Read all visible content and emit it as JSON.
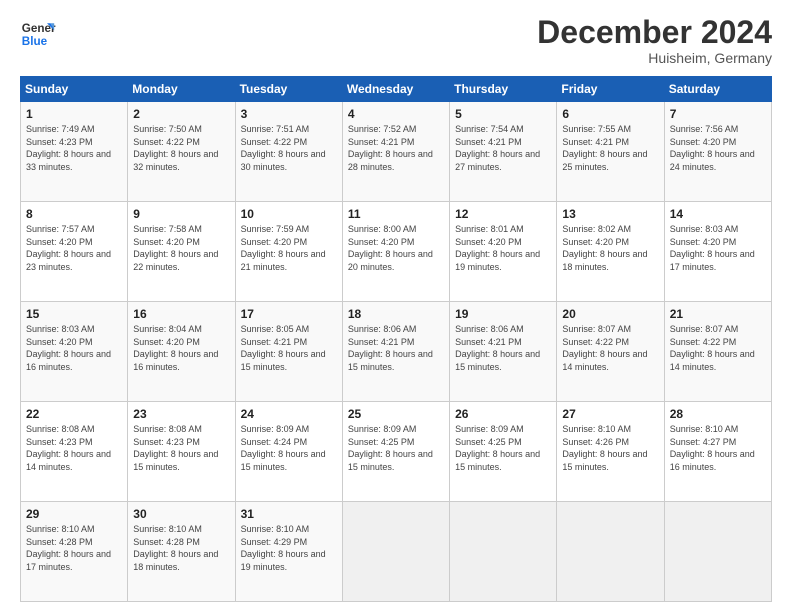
{
  "header": {
    "logo_line1": "General",
    "logo_line2": "Blue",
    "month_title": "December 2024",
    "location": "Huisheim, Germany"
  },
  "days_of_week": [
    "Sunday",
    "Monday",
    "Tuesday",
    "Wednesday",
    "Thursday",
    "Friday",
    "Saturday"
  ],
  "weeks": [
    [
      {
        "day": "1",
        "sunrise": "Sunrise: 7:49 AM",
        "sunset": "Sunset: 4:23 PM",
        "daylight": "Daylight: 8 hours and 33 minutes."
      },
      {
        "day": "2",
        "sunrise": "Sunrise: 7:50 AM",
        "sunset": "Sunset: 4:22 PM",
        "daylight": "Daylight: 8 hours and 32 minutes."
      },
      {
        "day": "3",
        "sunrise": "Sunrise: 7:51 AM",
        "sunset": "Sunset: 4:22 PM",
        "daylight": "Daylight: 8 hours and 30 minutes."
      },
      {
        "day": "4",
        "sunrise": "Sunrise: 7:52 AM",
        "sunset": "Sunset: 4:21 PM",
        "daylight": "Daylight: 8 hours and 28 minutes."
      },
      {
        "day": "5",
        "sunrise": "Sunrise: 7:54 AM",
        "sunset": "Sunset: 4:21 PM",
        "daylight": "Daylight: 8 hours and 27 minutes."
      },
      {
        "day": "6",
        "sunrise": "Sunrise: 7:55 AM",
        "sunset": "Sunset: 4:21 PM",
        "daylight": "Daylight: 8 hours and 25 minutes."
      },
      {
        "day": "7",
        "sunrise": "Sunrise: 7:56 AM",
        "sunset": "Sunset: 4:20 PM",
        "daylight": "Daylight: 8 hours and 24 minutes."
      }
    ],
    [
      {
        "day": "8",
        "sunrise": "Sunrise: 7:57 AM",
        "sunset": "Sunset: 4:20 PM",
        "daylight": "Daylight: 8 hours and 23 minutes."
      },
      {
        "day": "9",
        "sunrise": "Sunrise: 7:58 AM",
        "sunset": "Sunset: 4:20 PM",
        "daylight": "Daylight: 8 hours and 22 minutes."
      },
      {
        "day": "10",
        "sunrise": "Sunrise: 7:59 AM",
        "sunset": "Sunset: 4:20 PM",
        "daylight": "Daylight: 8 hours and 21 minutes."
      },
      {
        "day": "11",
        "sunrise": "Sunrise: 8:00 AM",
        "sunset": "Sunset: 4:20 PM",
        "daylight": "Daylight: 8 hours and 20 minutes."
      },
      {
        "day": "12",
        "sunrise": "Sunrise: 8:01 AM",
        "sunset": "Sunset: 4:20 PM",
        "daylight": "Daylight: 8 hours and 19 minutes."
      },
      {
        "day": "13",
        "sunrise": "Sunrise: 8:02 AM",
        "sunset": "Sunset: 4:20 PM",
        "daylight": "Daylight: 8 hours and 18 minutes."
      },
      {
        "day": "14",
        "sunrise": "Sunrise: 8:03 AM",
        "sunset": "Sunset: 4:20 PM",
        "daylight": "Daylight: 8 hours and 17 minutes."
      }
    ],
    [
      {
        "day": "15",
        "sunrise": "Sunrise: 8:03 AM",
        "sunset": "Sunset: 4:20 PM",
        "daylight": "Daylight: 8 hours and 16 minutes."
      },
      {
        "day": "16",
        "sunrise": "Sunrise: 8:04 AM",
        "sunset": "Sunset: 4:20 PM",
        "daylight": "Daylight: 8 hours and 16 minutes."
      },
      {
        "day": "17",
        "sunrise": "Sunrise: 8:05 AM",
        "sunset": "Sunset: 4:21 PM",
        "daylight": "Daylight: 8 hours and 15 minutes."
      },
      {
        "day": "18",
        "sunrise": "Sunrise: 8:06 AM",
        "sunset": "Sunset: 4:21 PM",
        "daylight": "Daylight: 8 hours and 15 minutes."
      },
      {
        "day": "19",
        "sunrise": "Sunrise: 8:06 AM",
        "sunset": "Sunset: 4:21 PM",
        "daylight": "Daylight: 8 hours and 15 minutes."
      },
      {
        "day": "20",
        "sunrise": "Sunrise: 8:07 AM",
        "sunset": "Sunset: 4:22 PM",
        "daylight": "Daylight: 8 hours and 14 minutes."
      },
      {
        "day": "21",
        "sunrise": "Sunrise: 8:07 AM",
        "sunset": "Sunset: 4:22 PM",
        "daylight": "Daylight: 8 hours and 14 minutes."
      }
    ],
    [
      {
        "day": "22",
        "sunrise": "Sunrise: 8:08 AM",
        "sunset": "Sunset: 4:23 PM",
        "daylight": "Daylight: 8 hours and 14 minutes."
      },
      {
        "day": "23",
        "sunrise": "Sunrise: 8:08 AM",
        "sunset": "Sunset: 4:23 PM",
        "daylight": "Daylight: 8 hours and 15 minutes."
      },
      {
        "day": "24",
        "sunrise": "Sunrise: 8:09 AM",
        "sunset": "Sunset: 4:24 PM",
        "daylight": "Daylight: 8 hours and 15 minutes."
      },
      {
        "day": "25",
        "sunrise": "Sunrise: 8:09 AM",
        "sunset": "Sunset: 4:25 PM",
        "daylight": "Daylight: 8 hours and 15 minutes."
      },
      {
        "day": "26",
        "sunrise": "Sunrise: 8:09 AM",
        "sunset": "Sunset: 4:25 PM",
        "daylight": "Daylight: 8 hours and 15 minutes."
      },
      {
        "day": "27",
        "sunrise": "Sunrise: 8:10 AM",
        "sunset": "Sunset: 4:26 PM",
        "daylight": "Daylight: 8 hours and 15 minutes."
      },
      {
        "day": "28",
        "sunrise": "Sunrise: 8:10 AM",
        "sunset": "Sunset: 4:27 PM",
        "daylight": "Daylight: 8 hours and 16 minutes."
      }
    ],
    [
      {
        "day": "29",
        "sunrise": "Sunrise: 8:10 AM",
        "sunset": "Sunset: 4:28 PM",
        "daylight": "Daylight: 8 hours and 17 minutes."
      },
      {
        "day": "30",
        "sunrise": "Sunrise: 8:10 AM",
        "sunset": "Sunset: 4:28 PM",
        "daylight": "Daylight: 8 hours and 18 minutes."
      },
      {
        "day": "31",
        "sunrise": "Sunrise: 8:10 AM",
        "sunset": "Sunset: 4:29 PM",
        "daylight": "Daylight: 8 hours and 19 minutes."
      },
      null,
      null,
      null,
      null
    ]
  ]
}
